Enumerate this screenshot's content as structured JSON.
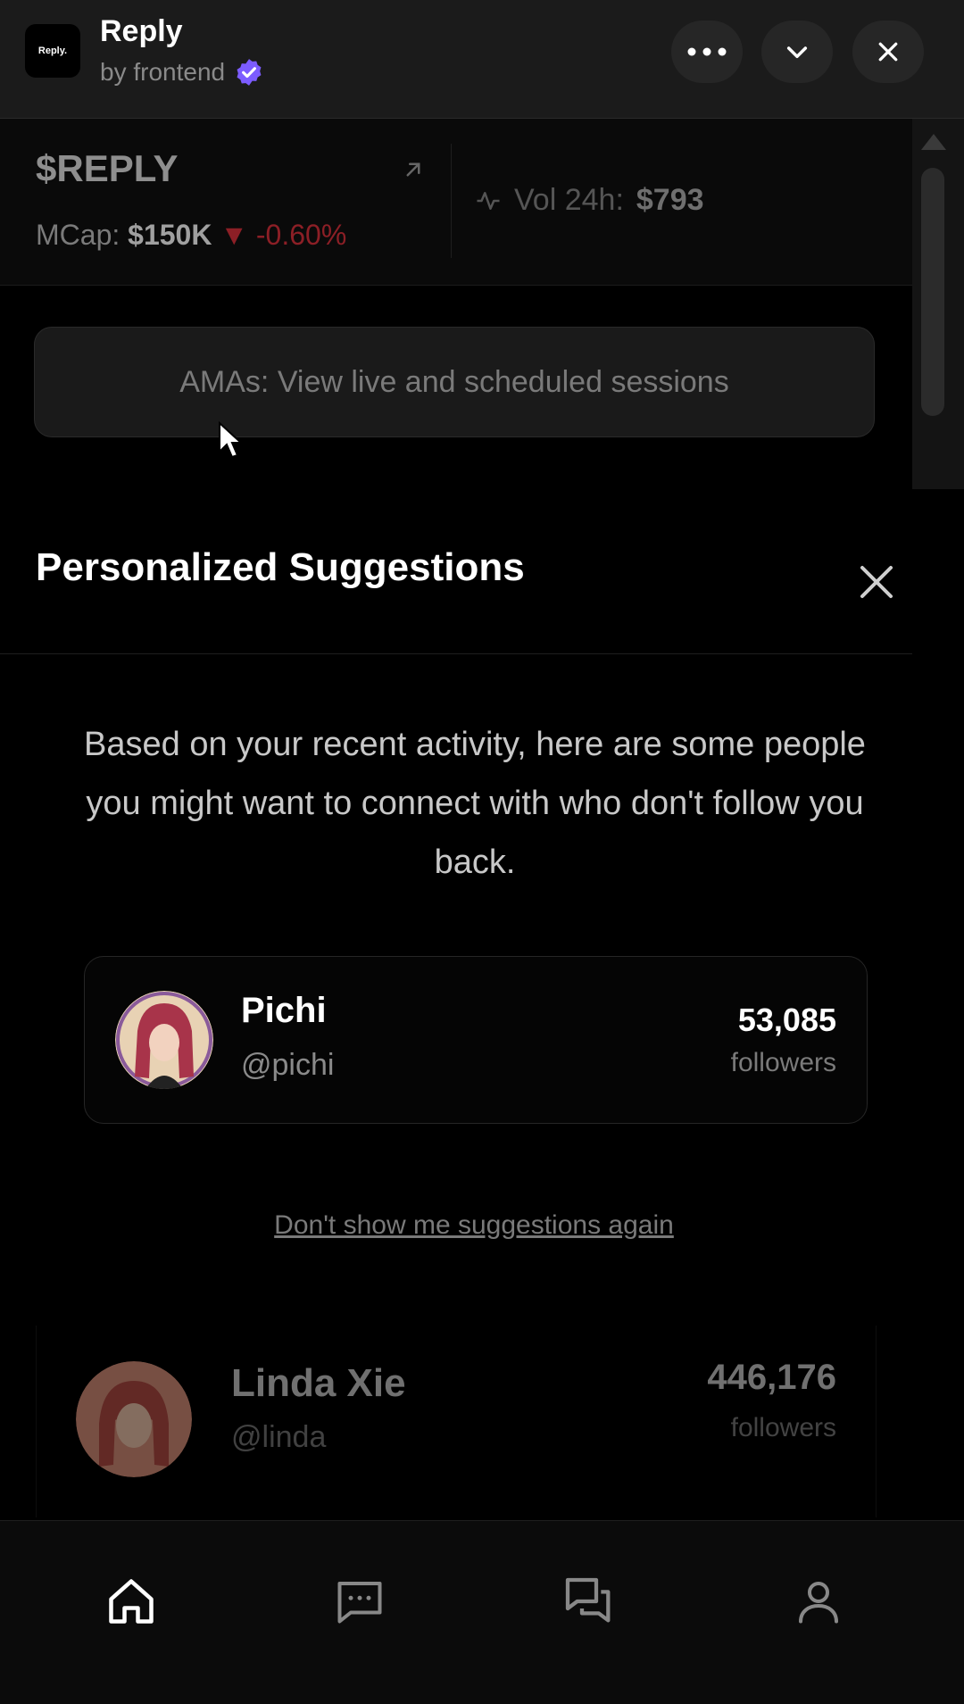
{
  "header": {
    "logo_text": "Reply.",
    "title": "Reply",
    "byline": "by frontend",
    "icons": [
      "more-horizontal-icon",
      "chevron-down-icon",
      "close-icon"
    ]
  },
  "ticker": {
    "symbol": "$REPLY",
    "mcap_label": "MCap:",
    "mcap_value": "$150K",
    "change": "-0.60%",
    "change_color": "#8c1f26",
    "vol_label": "Vol 24h:",
    "vol_value": "$793"
  },
  "ama_banner": "AMAs: View live and scheduled sessions",
  "suggestions": {
    "title": "Personalized Suggestions",
    "description": "Based on your recent activity, here are some people you might want to connect with who don't follow you back.",
    "people": [
      {
        "name": "Pichi",
        "handle": "@pichi",
        "followers": "53,085",
        "followers_label": "followers"
      }
    ],
    "dont_show": "Don't show me suggestions again"
  },
  "feed_preview": [
    {
      "name": "Linda Xie",
      "handle": "@linda",
      "followers": "446,176",
      "followers_label": "followers"
    }
  ],
  "bottom_nav": [
    "home-icon",
    "chat-icon",
    "messages-icon",
    "profile-icon"
  ],
  "colors": {
    "verified": "#7c5cff",
    "background": "#000000"
  }
}
